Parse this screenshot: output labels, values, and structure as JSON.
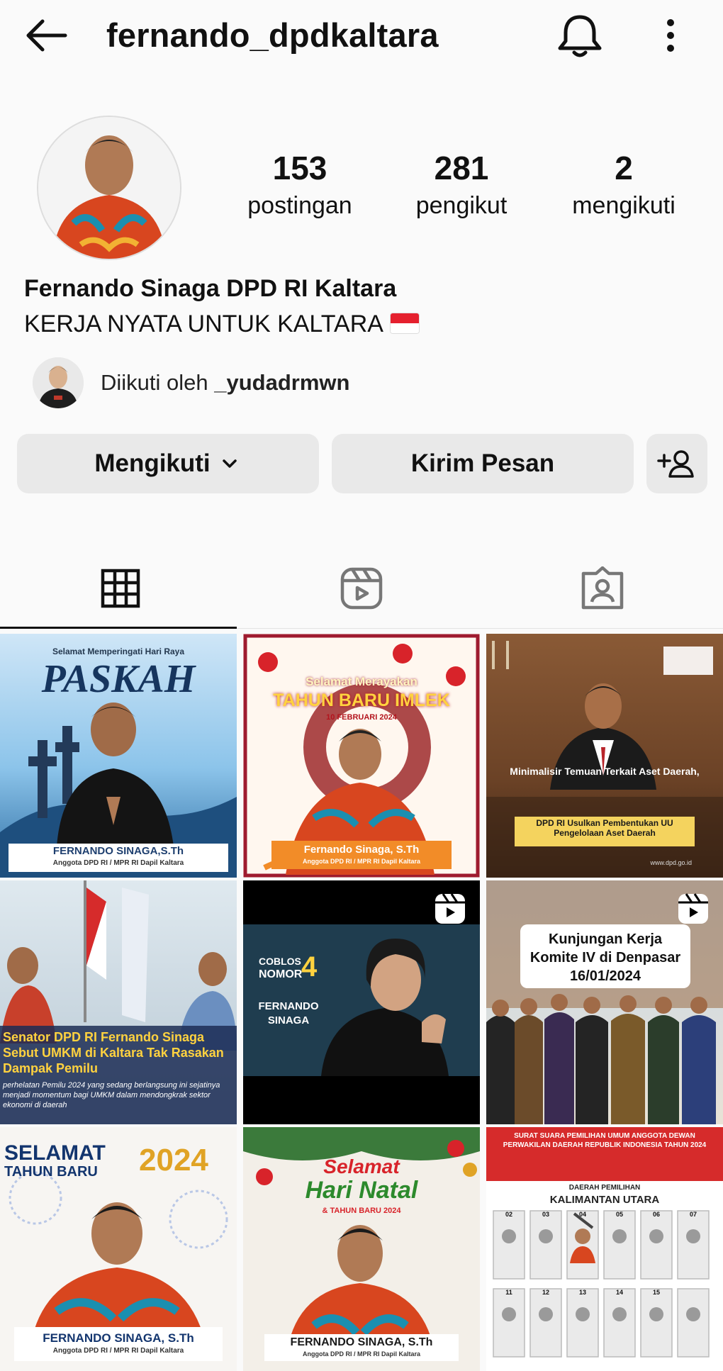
{
  "header": {
    "username": "fernando_dpdkaltara",
    "icons": [
      "back-arrow-icon",
      "bell-icon",
      "more-vertical-icon"
    ]
  },
  "stats": [
    {
      "value": "153",
      "label": "postingan"
    },
    {
      "value": "281",
      "label": "pengikut"
    },
    {
      "value": "2",
      "label": "mengikuti"
    }
  ],
  "profile": {
    "name": "Fernando Sinaga DPD RI Kaltara",
    "bio": "KERJA NYATA UNTUK KALTARA",
    "followed_by_prefix": "Diikuti oleh ",
    "followed_by_user": "_yudadrmwn"
  },
  "actions": {
    "follow_label": "Mengikuti",
    "message_label": "Kirim Pesan"
  },
  "tabs": [
    "grid-icon",
    "reels-icon",
    "tagged-icon"
  ],
  "posts": [
    {
      "line1": "Selamat Memperingati Hari Raya",
      "title": "PASKAH",
      "caption": "FERNANDO SINAGA,S.Th",
      "sub": "Anggota DPD RI / MPR RI Dapil Kaltara"
    },
    {
      "line1": "Selamat Merayakan",
      "title": "TAHUN BARU IMLEK",
      "date": "10 FEBRUARI 2024",
      "caption": "Fernando Sinaga, S.Th",
      "sub": "Anggota DPD RI / MPR RI Dapil Kaltara"
    },
    {
      "line1": "Minimalisir Temuan Terkait Aset Daerah,",
      "title": "DPD RI Usulkan Pembentukan UU Pengelolaan Aset Daerah",
      "footer": "www.dpd.go.id"
    },
    {
      "title": "Senator DPD RI Fernando Sinaga Sebut UMKM di Kaltara Tak Rasakan Dampak Pemilu",
      "body": "perhelatan Pemilu 2024 yang sedang berlangsung ini sejatinya menjadi momentum bagi UMKM dalam mendongkrak sektor ekonomi di daerah"
    },
    {
      "line1": "COBLOS",
      "line2": "NOMOR",
      "number": "4",
      "caption": "FERNANDO SINAGA"
    },
    {
      "title": "Kunjungan Kerja Komite IV di Denpasar 16/01/2024"
    },
    {
      "line1": "SELAMAT",
      "line2": "TAHUN BARU",
      "title": "2024",
      "caption": "FERNANDO SINAGA, S.Th",
      "sub": "Anggota DPD RI / MPR RI Dapil Kaltara"
    },
    {
      "line1": "Selamat",
      "title": "Hari Natal",
      "line2": "& TAHUN BARU 2024",
      "caption": "FERNANDO SINAGA, S.Th",
      "sub": "Anggota DPD RI / MPR RI Dapil Kaltara"
    },
    {
      "line1": "SURAT SUARA PEMILIHAN UMUM ANGGOTA DEWAN PERWAKILAN DAERAH REPUBLIK INDONESIA TAHUN 2024",
      "line2": "DAERAH PEMILIHAN",
      "title": "KALIMANTAN UTARA",
      "numbers": [
        "02",
        "03",
        "04",
        "05",
        "06",
        "07",
        "11",
        "12",
        "13",
        "14",
        "15"
      ]
    }
  ]
}
